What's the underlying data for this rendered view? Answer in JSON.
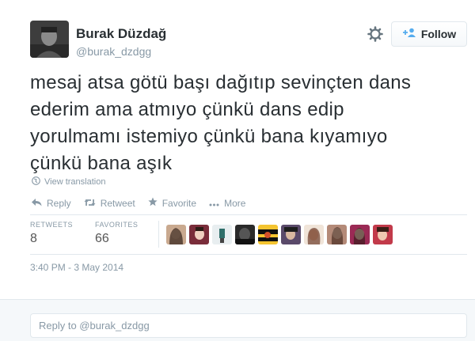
{
  "user": {
    "name": "Burak Düzdağ",
    "handle": "@burak_dzdgg"
  },
  "header": {
    "follow_label": "Follow"
  },
  "tweet": {
    "lines": [
      "mesaj atsa götü başı dağıtıp sevinçten dans",
      "ederim ama atmıyo çünkü dans edip",
      "yorulmamı istemiyo çünkü bana kıyamıyo",
      "çünkü bana aşık"
    ],
    "translate_label": "View translation"
  },
  "actions": {
    "reply": "Reply",
    "retweet": "Retweet",
    "favorite": "Favorite",
    "more": "More"
  },
  "stats": {
    "retweets_label": "RETWEETS",
    "retweets_value": "8",
    "favorites_label": "FAVORITES",
    "favorites_value": "66"
  },
  "timestamp": "3:40 PM - 3 May 2014",
  "reply_box": {
    "placeholder": "Reply to @burak_dzdgg"
  },
  "colors": {
    "muted": "#8899a6",
    "text": "#292f33",
    "accent": "#55acee"
  },
  "icons": {
    "gear": "gear-icon",
    "follow": "add-user-icon",
    "reply": "reply-icon",
    "retweet": "retweet-icon",
    "favorite": "star-icon",
    "more": "more-icon",
    "translate": "globe-icon"
  },
  "favoriters_count_shown": 10
}
